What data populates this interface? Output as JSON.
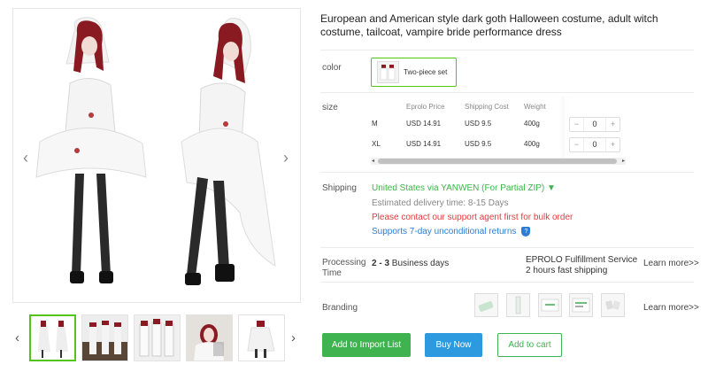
{
  "product": {
    "title": "European and American style dark goth Halloween costume, adult witch costume, tailcoat, vampire bride performance dress"
  },
  "gallery": {
    "prev_icon": "chevron-left-icon",
    "next_icon": "chevron-right-icon",
    "thumb_count": 5,
    "active_index": 0
  },
  "color": {
    "label": "color",
    "option": "Two-piece set"
  },
  "size": {
    "label": "size",
    "headers": [
      "Eprolo Price",
      "Shipping Cost",
      "Weight"
    ],
    "rows": [
      {
        "size": "M",
        "price": "USD 14.91",
        "shipping": "USD 9.5",
        "weight": "400g",
        "qty": "0"
      },
      {
        "size": "XL",
        "price": "USD 14.91",
        "shipping": "USD 9.5",
        "weight": "400g",
        "qty": "0"
      }
    ],
    "minus": "−",
    "plus": "+"
  },
  "shipping": {
    "label": "Shipping",
    "method": "United States via YANWEN (For Partial ZIP) ▼",
    "delivery": "Estimated delivery time: 8-15 Days",
    "bulk_notice": "Please contact our support agent first for bulk order",
    "returns": "Supports 7-day unconditional returns",
    "returns_icon": "shield-icon"
  },
  "processing": {
    "label_line1": "Processing",
    "label_line2": "Time",
    "days_bold": "2 - 3",
    "days_rest": " Business days",
    "service_line1": "EPROLO Fulfillment Service",
    "service_line2": "2 hours fast shipping",
    "learn_more": "Learn more>>"
  },
  "branding": {
    "label": "Branding",
    "learn_more": "Learn more>>"
  },
  "actions": {
    "import": "Add to Import List",
    "buy": "Buy Now",
    "cart": "Add to cart"
  },
  "colors": {
    "accent_green": "#3fb34f",
    "accent_blue": "#2d9ae0",
    "alert_red": "#e4393c"
  }
}
